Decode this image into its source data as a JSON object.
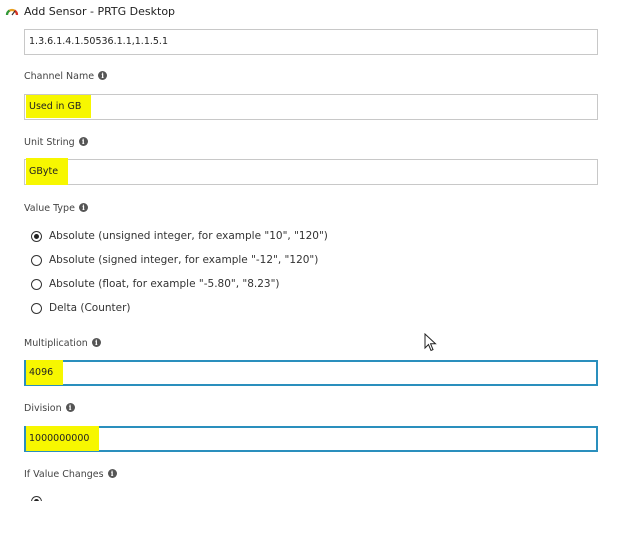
{
  "window": {
    "title": "Add Sensor - PRTG Desktop",
    "icon": "prtg-gauge-icon"
  },
  "fields": {
    "oid": {
      "value": "1.3.6.1.4.1.50536.1.1,1.1.5.1"
    },
    "channel_name": {
      "label": "Channel Name",
      "value": "Used in GB"
    },
    "unit_string": {
      "label": "Unit String",
      "value": "GByte"
    },
    "value_type": {
      "label": "Value Type",
      "options": [
        {
          "label": "Absolute (unsigned integer, for example \"10\", \"120\")",
          "selected": true
        },
        {
          "label": "Absolute (signed integer, for example \"-12\", \"120\")",
          "selected": false
        },
        {
          "label": "Absolute (float, for example \"-5.80\", \"8.23\")",
          "selected": false
        },
        {
          "label": "Delta (Counter)",
          "selected": false
        }
      ]
    },
    "multiplication": {
      "label": "Multiplication",
      "value": "4096"
    },
    "division": {
      "label": "Division",
      "value": "1000000000"
    },
    "if_value_changes": {
      "label": "If Value Changes"
    }
  },
  "colors": {
    "highlight": "#f7f700",
    "focus_border": "#2a8fbd",
    "field_border": "#c8c8c8"
  }
}
